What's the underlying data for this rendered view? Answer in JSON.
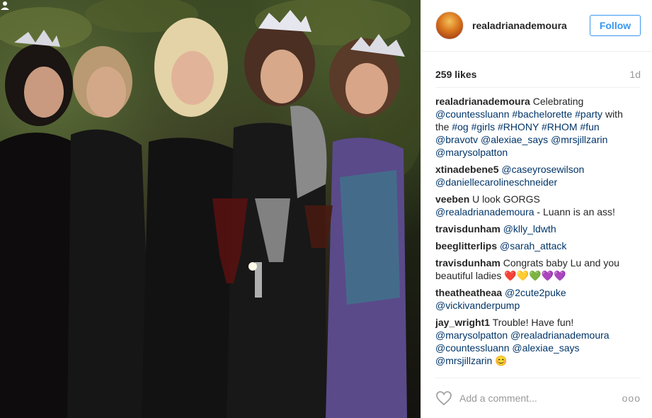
{
  "post": {
    "username": "realadrianademoura",
    "follow_label": "Follow",
    "likes": "259 likes",
    "age": "1d",
    "comment_placeholder": "Add a comment...",
    "more_label": "ooo"
  },
  "comments": [
    {
      "user": "realadrianademoura",
      "parts": [
        {
          "t": "Celebrating ",
          "link": false
        },
        {
          "t": "@countessluann",
          "link": true
        },
        {
          "t": " ",
          "link": false
        },
        {
          "t": "#bachelorette",
          "link": true
        },
        {
          "t": " ",
          "link": false
        },
        {
          "t": "#party",
          "link": true
        },
        {
          "t": " with the ",
          "link": false
        },
        {
          "t": "#og",
          "link": true
        },
        {
          "t": " ",
          "link": false
        },
        {
          "t": "#girls",
          "link": true
        },
        {
          "t": " ",
          "link": false
        },
        {
          "t": "#RHONY",
          "link": true
        },
        {
          "t": " ",
          "link": false
        },
        {
          "t": "#RHOM",
          "link": true
        },
        {
          "t": " ",
          "link": false
        },
        {
          "t": "#fun",
          "link": true
        },
        {
          "t": " ",
          "link": false
        },
        {
          "t": "@bravotv",
          "link": true
        },
        {
          "t": " ",
          "link": false
        },
        {
          "t": "@alexiae_says",
          "link": true
        },
        {
          "t": " ",
          "link": false
        },
        {
          "t": "@mrsjillzarin",
          "link": true
        },
        {
          "t": " ",
          "link": false
        },
        {
          "t": "@marysolpatton",
          "link": true
        }
      ]
    },
    {
      "user": "xtinadebene5",
      "parts": [
        {
          "t": "@caseyrosewilson",
          "link": true
        },
        {
          "t": " ",
          "link": false
        },
        {
          "t": "@daniellecarolineschneider",
          "link": true
        }
      ]
    },
    {
      "user": "veeben",
      "parts": [
        {
          "t": "U look GORGS ",
          "link": false
        },
        {
          "t": "@realadrianademoura",
          "link": true
        },
        {
          "t": " - Luann is an ass!",
          "link": false
        }
      ]
    },
    {
      "user": "travisdunham",
      "parts": [
        {
          "t": "@klly_ldwth",
          "link": true
        }
      ]
    },
    {
      "user": "beeglitterlips",
      "parts": [
        {
          "t": "@sarah_attack",
          "link": true
        }
      ]
    },
    {
      "user": "travisdunham",
      "parts": [
        {
          "t": "Congrats baby Lu and you beautiful ladies ❤️💛💚💜💜",
          "link": false
        }
      ]
    },
    {
      "user": "theatheatheaa",
      "parts": [
        {
          "t": "@2cute2puke",
          "link": true
        },
        {
          "t": " ",
          "link": false
        },
        {
          "t": "@vickivanderpump",
          "link": true
        }
      ]
    },
    {
      "user": "jay_wright1",
      "parts": [
        {
          "t": "Trouble! Have fun! ",
          "link": false
        },
        {
          "t": "@marysolpatton",
          "link": true
        },
        {
          "t": " ",
          "link": false
        },
        {
          "t": "@realadrianademoura",
          "link": true
        },
        {
          "t": " ",
          "link": false
        },
        {
          "t": "@countessluann",
          "link": true
        },
        {
          "t": " ",
          "link": false
        },
        {
          "t": "@alexiae_says",
          "link": true
        },
        {
          "t": " ",
          "link": false
        },
        {
          "t": "@mrsjillzarin",
          "link": true
        },
        {
          "t": " 😊",
          "link": false
        }
      ]
    }
  ],
  "colors": {
    "accent": "#3897f0",
    "link": "#003569",
    "muted": "#999999",
    "divider": "#efefef"
  },
  "icons": {
    "like": "heart-outline-icon",
    "more": "ellipsis-icon",
    "photo_user": "user-tag-icon"
  }
}
